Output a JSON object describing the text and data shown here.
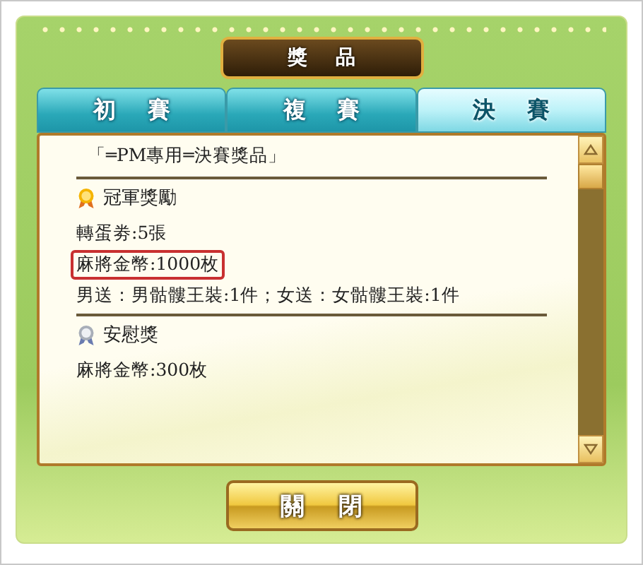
{
  "title": "獎品",
  "tabs": [
    {
      "label": "初賽",
      "selected": false
    },
    {
      "label": "複賽",
      "selected": false
    },
    {
      "label": "決賽",
      "selected": true
    }
  ],
  "heading": "「═PM專用═決賽獎品」",
  "sections": [
    {
      "kind": "gold",
      "title": "冠軍獎勵",
      "lines": [
        {
          "text": "轉蛋劵:5張",
          "highlighted": false
        },
        {
          "text": "麻將金幣:1000枚",
          "highlighted": true
        },
        {
          "text": "男送：男骷髏王裝:1件；女送：女骷髏王裝:1件",
          "highlighted": false
        }
      ]
    },
    {
      "kind": "silver",
      "title": "安慰獎",
      "lines": [
        {
          "text": "麻將金幣:300枚",
          "highlighted": false
        }
      ]
    }
  ],
  "close_button": "關閉"
}
